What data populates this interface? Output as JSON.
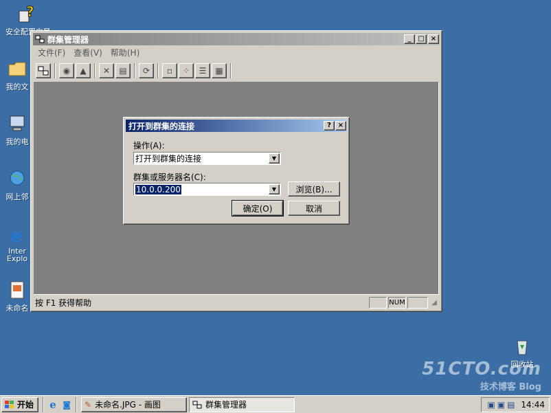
{
  "desktop": {
    "icons": [
      {
        "label": "安全配置向导"
      },
      {
        "label": "我的文"
      },
      {
        "label": "我的电"
      },
      {
        "label": "网上邻"
      },
      {
        "label": "Inter"
      },
      {
        "label": "Explo"
      },
      {
        "label": "未命名"
      },
      {
        "label": "回收站"
      }
    ]
  },
  "main_window": {
    "title": "群集管理器",
    "menu": [
      "文件(F)",
      "查看(V)",
      "帮助(H)"
    ],
    "status_text": "按 F1 获得帮助",
    "status_num": "NUM"
  },
  "dialog": {
    "title": "打开到群集的连接",
    "help_btn": "?",
    "close_btn": "×",
    "action_label": "操作(A):",
    "action_value": "打开到群集的连接",
    "cluster_label": "群集或服务器名(C):",
    "cluster_value": "10.0.0.200",
    "browse_label": "浏览(B)...",
    "ok_label": "确定(O)",
    "cancel_label": "取消"
  },
  "taskbar": {
    "start_label": "开始",
    "tasks": [
      {
        "label": "未命名.JPG - 画图"
      },
      {
        "label": "群集管理器"
      }
    ],
    "clock": "14:44"
  },
  "watermark": {
    "line1": "51CTO.com",
    "line2": "技术博客 Blog"
  },
  "colors": {
    "desktop": "#3a6ea5",
    "title_active": "#0a246a",
    "title_inactive": "#808080",
    "face": "#d4d0c8"
  }
}
